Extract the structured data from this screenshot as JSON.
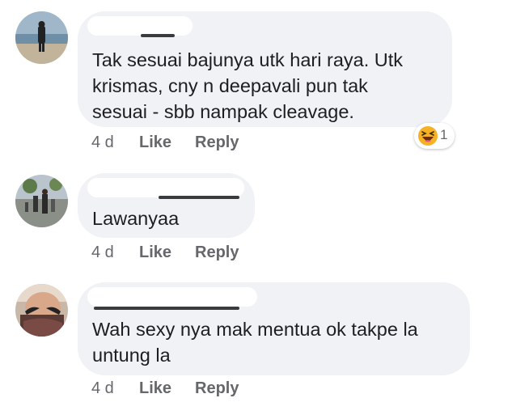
{
  "comments": [
    {
      "text_lines": [
        "Tak sesuai bajunya utk hari raya. Utk",
        "krismas, cny n deepavali pun tak",
        "sesuai - sbb nampak cleavage."
      ],
      "time": "4 d",
      "like_label": "Like",
      "reply_label": "Reply",
      "reaction": {
        "icon": "laughing-emoji-icon",
        "count": "1"
      }
    },
    {
      "text_lines": [
        "Lawanyaa"
      ],
      "time": "4 d",
      "like_label": "Like",
      "reply_label": "Reply"
    },
    {
      "text_lines": [
        "Wah sexy nya mak mentua ok takpe la",
        "untung la"
      ],
      "time": "4 d",
      "like_label": "Like",
      "reply_label": "Reply"
    }
  ],
  "colors": {
    "bubble_background": "#f0f2f5",
    "text": "#1c1e21",
    "secondary_text": "#65676b",
    "reaction_emoji": "#f7b125"
  }
}
